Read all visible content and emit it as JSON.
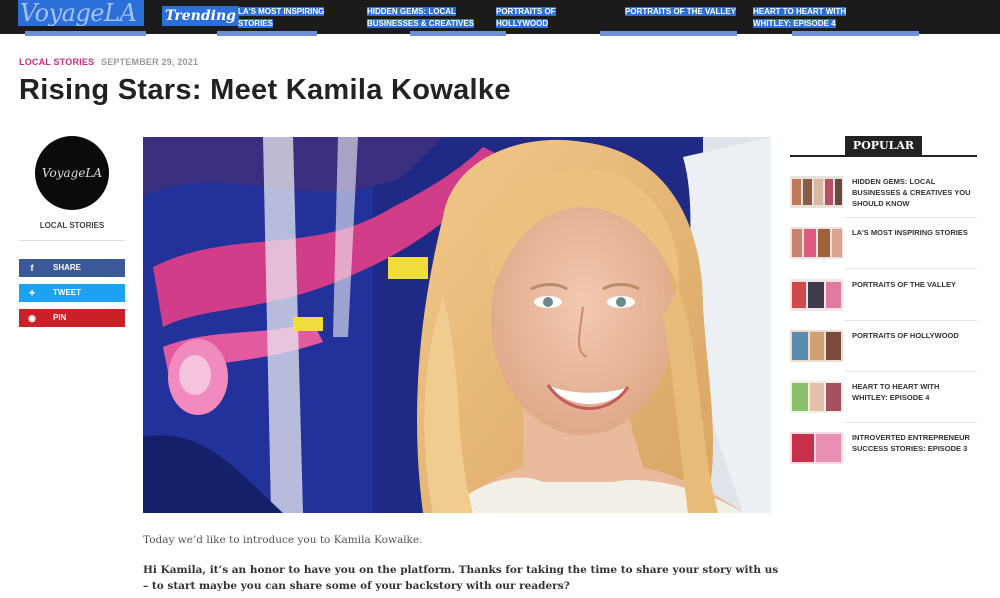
{
  "header": {
    "logo": "VoyageLA",
    "trending_label": "Trending",
    "trending_links": [
      "LA's Most Inspiring Stories",
      "Hidden Gems: Local Businesses & Creatives",
      "Portraits of Hollywood",
      "Portraits of the Valley",
      "Heart to Heart with Whitley: Episode 4"
    ]
  },
  "article": {
    "category": "LOCAL STORIES",
    "date": "SEPTEMBER 29, 2021",
    "title": "Rising Stars: Meet Kamila Kowalke",
    "intro": "Today we’d like to introduce you to Kamila Kowalke.",
    "question": "Hi Kamila, it’s an honor to have you on the platform. Thanks for taking the time to share your story with us – to start maybe you can share some of your backstory with our readers?"
  },
  "author": {
    "avatar_text": "VoyageLA",
    "category": "LOCAL STORIES"
  },
  "share": {
    "facebook": "SHARE",
    "twitter": "TWEET",
    "pinterest": "PIN"
  },
  "sidebar": {
    "popular_label": "POPULAR",
    "items": [
      {
        "title": "HIDDEN GEMS: LOCAL BUSINESSES & CREATIVES YOU SHOULD KNOW"
      },
      {
        "title": "LA'S MOST INSPIRING STORIES"
      },
      {
        "title": "PORTRAITS OF THE VALLEY"
      },
      {
        "title": "PORTRAITS OF HOLLYWOOD"
      },
      {
        "title": "HEART TO HEART WITH WHITLEY: EPISODE 4"
      },
      {
        "title": "INTROVERTED ENTREPRENEUR SUCCESS STORIES: EPISODE 3"
      }
    ]
  },
  "colors": {
    "category": "#c6307e",
    "facebook": "#3b5998",
    "twitter": "#1da1f2",
    "pinterest": "#cb2027",
    "selection_highlight": "#2d6fd9"
  }
}
